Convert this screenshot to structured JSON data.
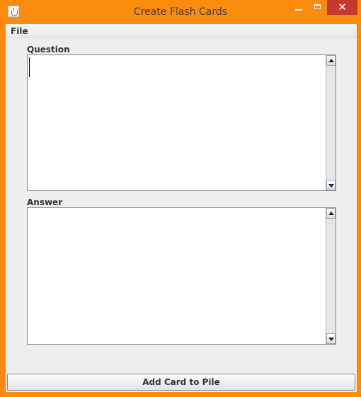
{
  "window": {
    "title": "Create Flash Cards",
    "icon": "java-cup-icon",
    "controls": {
      "minimize": "minimize-icon",
      "maximize": "maximize-icon",
      "close_label": "✕"
    },
    "frame_color": "#fb8b0c",
    "close_color": "#c7382f"
  },
  "menubar": {
    "items": [
      {
        "label": "File"
      }
    ]
  },
  "question": {
    "label": "Question",
    "value": ""
  },
  "answer": {
    "label": "Answer",
    "value": ""
  },
  "actions": {
    "add_label": "Add Card to Pile"
  }
}
